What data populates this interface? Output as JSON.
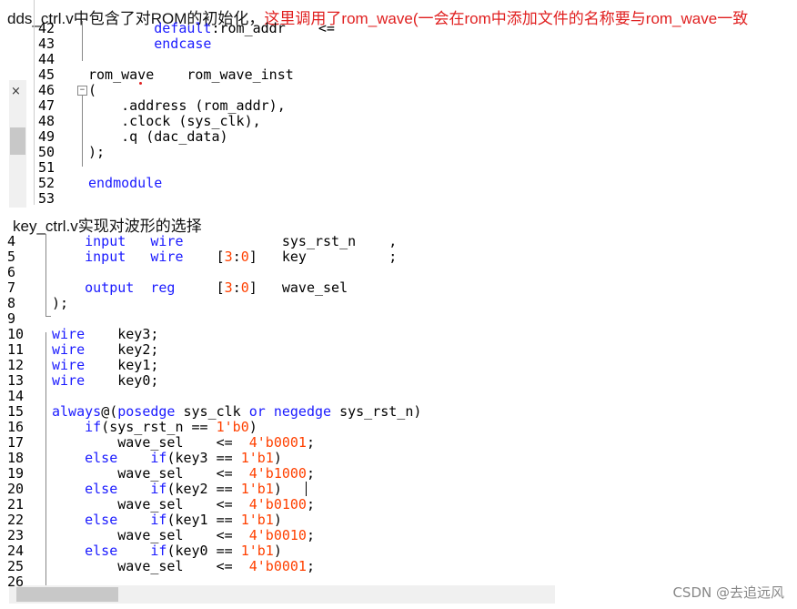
{
  "heading1": {
    "part1": "dds_ctrl.v中包含了对ROM的初始化，",
    "part2": "这里调用了rom_wave(一会在rom中添加文件的名称要与rom_wave一致"
  },
  "editor1": {
    "lines": [
      {
        "n": "42",
        "code": "        default:rom_addr    <="
      },
      {
        "n": "43",
        "code": "        endcase"
      },
      {
        "n": "44",
        "code": ""
      },
      {
        "n": "45",
        "code": "rom_wave    rom_wave_inst"
      },
      {
        "n": "46",
        "code": "("
      },
      {
        "n": "47",
        "code": "    .address (rom_addr),"
      },
      {
        "n": "48",
        "code": "    .clock (sys_clk),"
      },
      {
        "n": "49",
        "code": "    .q (dac_data)"
      },
      {
        "n": "50",
        "code": ");"
      },
      {
        "n": "51",
        "code": ""
      },
      {
        "n": "52",
        "code": "endmodule"
      },
      {
        "n": "53",
        "code": ""
      }
    ],
    "close_glyph": "×"
  },
  "heading2": {
    "text": "key_ctrl.v实现对波形的选择"
  },
  "editor2": {
    "lines": [
      {
        "n": "4",
        "a": "    input   wire            sys_rst_n    ,"
      },
      {
        "n": "5",
        "a": "    input   wire    [3:0]   key          ;"
      },
      {
        "n": "6",
        "a": ""
      },
      {
        "n": "7",
        "a": "    output  reg     [3:0]   wave_sel"
      },
      {
        "n": "8",
        "a": ");"
      },
      {
        "n": "9",
        "a": ""
      },
      {
        "n": "10",
        "a": "wire    key3;"
      },
      {
        "n": "11",
        "a": "wire    key2;"
      },
      {
        "n": "12",
        "a": "wire    key1;"
      },
      {
        "n": "13",
        "a": "wire    key0;"
      },
      {
        "n": "14",
        "a": ""
      },
      {
        "n": "15",
        "a": "always@(posedge sys_clk or negedge sys_rst_n)"
      },
      {
        "n": "16",
        "a": "    if(sys_rst_n == 1'b0)"
      },
      {
        "n": "17",
        "a": "        wave_sel    <=  4'b0001;"
      },
      {
        "n": "18",
        "a": "    else    if(key3 == 1'b1)"
      },
      {
        "n": "19",
        "a": "        wave_sel    <=  4'b1000;"
      },
      {
        "n": "20",
        "a": "    else    if(key2 == 1'b1)"
      },
      {
        "n": "21",
        "a": "        wave_sel    <=  4'b0100;"
      },
      {
        "n": "22",
        "a": "    else    if(key1 == 1'b1)"
      },
      {
        "n": "23",
        "a": "        wave_sel    <=  4'b0010;"
      },
      {
        "n": "24",
        "a": "    else    if(key0 == 1'b1)"
      },
      {
        "n": "25",
        "a": "        wave_sel    <=  4'b0001;"
      },
      {
        "n": "26",
        "a": ""
      }
    ]
  },
  "watermark": "CSDN @去追远风",
  "colors": {
    "keyword": "#1a1aff",
    "number": "#ff4000",
    "heading_red": "#e02020"
  }
}
